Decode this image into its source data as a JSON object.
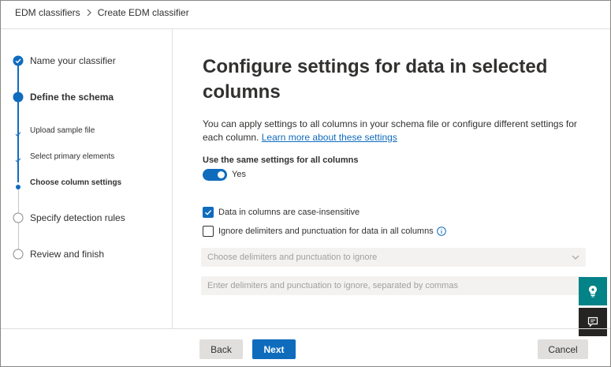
{
  "breadcrumb": {
    "items": [
      "EDM classifiers",
      "Create EDM classifier"
    ]
  },
  "steps": {
    "name_classifier": "Name your classifier",
    "define_schema": "Define the schema",
    "upload_sample": "Upload sample file",
    "select_primary": "Select primary elements",
    "choose_columns": "Choose column settings",
    "detection_rules": "Specify detection rules",
    "review_finish": "Review and finish"
  },
  "main": {
    "title": "Configure settings for data in selected columns",
    "description": "You can apply settings to all columns in your schema file or configure different settings for each column.",
    "learn_more_link": "Learn more about these settings",
    "same_settings_label": "Use the same settings for all columns",
    "toggle_value": "Yes",
    "case_insensitive_label": "Data in columns are case-insensitive",
    "case_insensitive_checked": true,
    "ignore_delimiters_label": "Ignore delimiters and punctuation for data in all columns",
    "ignore_delimiters_checked": false,
    "delimiters_dropdown_placeholder": "Choose delimiters and punctuation to ignore",
    "delimiters_input_placeholder": "Enter delimiters and punctuation to ignore, separated by commas"
  },
  "footer": {
    "back_label": "Back",
    "next_label": "Next",
    "cancel_label": "Cancel"
  },
  "icons": {
    "breadcrumb_separator": "chevron-right-icon",
    "completed_step": "check-circle-icon",
    "current_step": "filled-circle-icon",
    "pending_step": "empty-circle-icon",
    "info": "info-icon",
    "dropdown": "chevron-down-icon",
    "side_help": "lightbulb-icon",
    "side_feedback": "feedback-icon"
  },
  "colors": {
    "accent": "#0f6cbd",
    "side_help_bg": "#038387",
    "side_feedback_bg": "#252423"
  }
}
